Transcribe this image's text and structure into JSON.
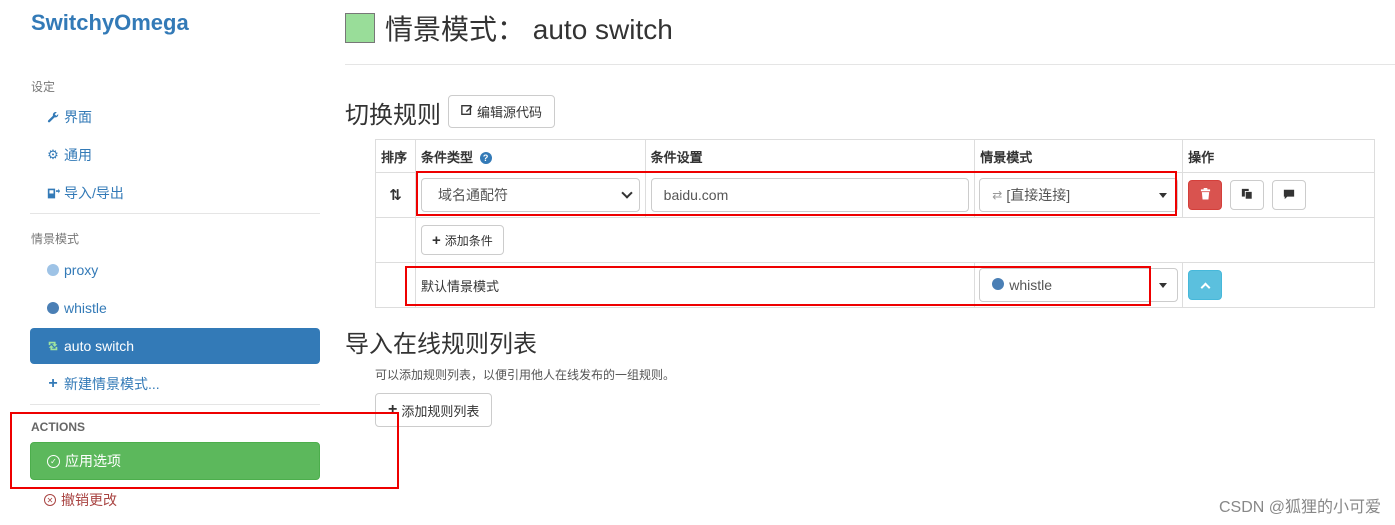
{
  "brand": "SwitchyOmega",
  "sidebar": {
    "settings_header": "设定",
    "settings_items": [
      {
        "label": "界面",
        "icon": "wrench-icon"
      },
      {
        "label": "通用",
        "icon": "gear-icon"
      },
      {
        "label": "导入/导出",
        "icon": "import-export-icon"
      }
    ],
    "profiles_header": "情景模式",
    "profiles": [
      {
        "label": "proxy",
        "icon": "globe-icon"
      },
      {
        "label": "whistle",
        "icon": "globe-icon"
      },
      {
        "label": "auto switch",
        "icon": "retweet-icon",
        "active": true
      }
    ],
    "new_profile": "新建情景模式...",
    "actions_header": "ACTIONS",
    "apply_label": "应用选项",
    "discard_label": "撤销更改"
  },
  "main": {
    "title": "情景模式： auto switch",
    "swatch_color": "#99dd99",
    "switch_rules_title": "切换规则",
    "edit_source_label": "编辑源代码",
    "table": {
      "headers": [
        "排序",
        "条件类型",
        "条件设置",
        "情景模式",
        "操作"
      ],
      "rule": {
        "condition_type": "域名通配符",
        "condition_value": "baidu.com",
        "profile": "[直接连接]"
      },
      "add_condition_label": "添加条件",
      "default_label": "默认情景模式",
      "default_profile": "whistle"
    },
    "online_rules_title": "导入在线规则列表",
    "online_rules_desc": "可以添加规则列表，以便引用他人在线发布的一组规则。",
    "add_rule_list_label": "添加规则列表"
  },
  "watermark": "CSDN @狐狸的小可爱",
  "colors": {
    "primary": "#337ab7",
    "success": "#5cb85c",
    "danger": "#d9534f",
    "info": "#5bc0de",
    "highlight": "#e00000"
  }
}
